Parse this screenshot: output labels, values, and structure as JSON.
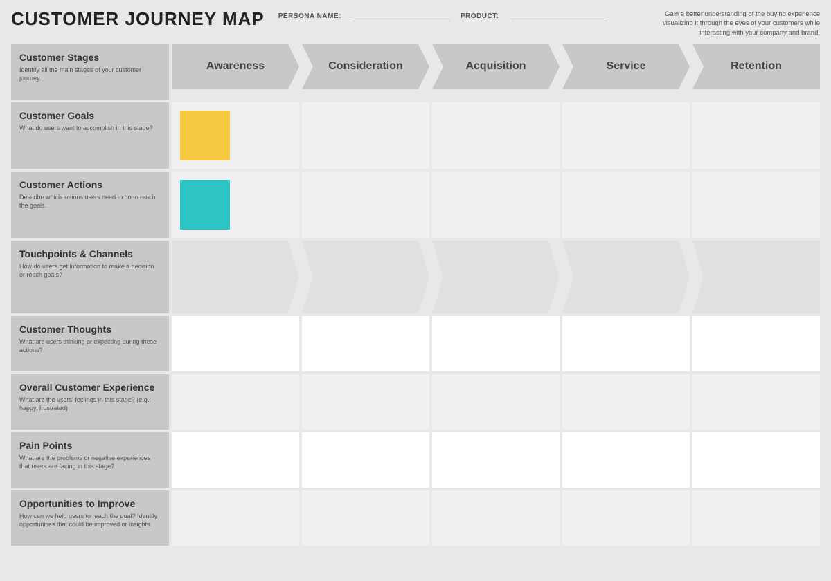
{
  "header": {
    "title": "CUSTOMER JOURNEY MAP",
    "persona_label": "PERSONA NAME:",
    "persona_value": "",
    "product_label": "PRODUCT:",
    "product_value": "",
    "description": "Gain a better understanding of the buying experience visualizing it through the eyes of your customers while interacting with your company and brand."
  },
  "stages": [
    {
      "id": "awareness",
      "label": "Awareness",
      "position": "first"
    },
    {
      "id": "consideration",
      "label": "Consideration",
      "position": "middle"
    },
    {
      "id": "acquisition",
      "label": "Acquisition",
      "position": "middle"
    },
    {
      "id": "service",
      "label": "Service",
      "position": "middle"
    },
    {
      "id": "retention",
      "label": "Retention",
      "position": "last"
    }
  ],
  "rows": [
    {
      "id": "customer-stages",
      "title": "Customer Stages",
      "description": "Identify all the main stages of your customer journey.",
      "type": "stages"
    },
    {
      "id": "customer-goals",
      "title": "Customer Goals",
      "description": "What do users want to accomplish in this stage?",
      "type": "goals"
    },
    {
      "id": "customer-actions",
      "title": "Customer Actions",
      "description": "Describe which actions users need to do to reach the goals.",
      "type": "actions"
    },
    {
      "id": "touchpoints-channels",
      "title": "Touchpoints & Channels",
      "description": "How do users get information to make a decision or reach goals?",
      "type": "touchpoints"
    },
    {
      "id": "customer-thoughts",
      "title": "Customer Thoughts",
      "description": "What are users thinking or expecting during these actions?",
      "type": "thoughts"
    },
    {
      "id": "overall-experience",
      "title": "Overall Customer Experience",
      "description": "What are the users' feelings in this stage? (e.g.: happy, frustrated)",
      "type": "experience"
    },
    {
      "id": "pain-points",
      "title": "Pain Points",
      "description": "What are the problems or negative experiences that users are facing in this stage?",
      "type": "pain"
    },
    {
      "id": "opportunities",
      "title": "Opportunities to Improve",
      "description": "How can we help users to reach the goal? Identify opportunities that could be improved or insights.",
      "type": "opportunities"
    }
  ]
}
